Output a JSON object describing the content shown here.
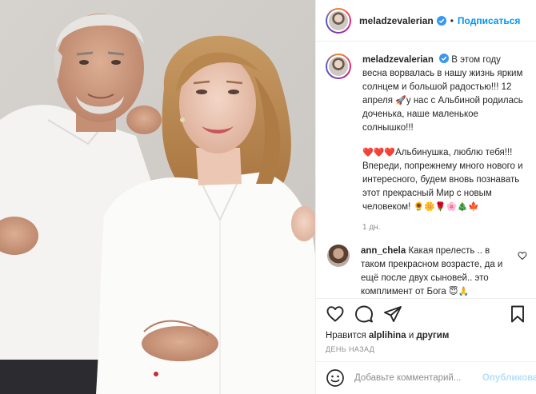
{
  "header": {
    "username": "meladzevalerian",
    "dot": "•",
    "follow_label": "Подписаться"
  },
  "caption": {
    "username": "meladzevalerian",
    "para1_a": "В этом году весна ворвалась в нашу жизнь ярким солнцем и большой радостью!!! 12 апреля ",
    "para1_emoji": "🚀",
    "para1_b": "у нас с Альбиной родилась доченька, наше маленькое солнышко!!!",
    "para2_emoji_lead": "❤️❤️❤️",
    "para2": "Альбинушка, люблю тебя!!! Впереди, попрежнему много нового и интересного, будем вновь познавать этот прекрасный Мир с новым человеком! ",
    "para2_emoji_tail": "🌻🌼🌹🌸🎄🍁",
    "time": "1 дн."
  },
  "comment": {
    "username": "ann_chela",
    "text": "Какая прелесть .. в таком прекрасном возрасте, да и ещё после двух сыновей.. это комплимент от Бога ",
    "emoji": "😇🙏"
  },
  "likes": {
    "prefix": "Нравится",
    "user": "alplihina",
    "and": "и",
    "others": "другим"
  },
  "date_label": "ДЕНЬ НАЗАД",
  "add_comment": {
    "placeholder": "Добавьте комментарий...",
    "publish_label": "Опубликовать"
  },
  "icons": [
    "heart-icon",
    "comment-icon",
    "share-icon",
    "bookmark-icon",
    "smile-icon",
    "verified-badge-icon"
  ],
  "colors": {
    "accent_blue": "#0095f6",
    "publish_disabled": "#b2dffc",
    "muted_text": "#8e8e8e",
    "text": "#262626",
    "verified": "#3897f0"
  }
}
